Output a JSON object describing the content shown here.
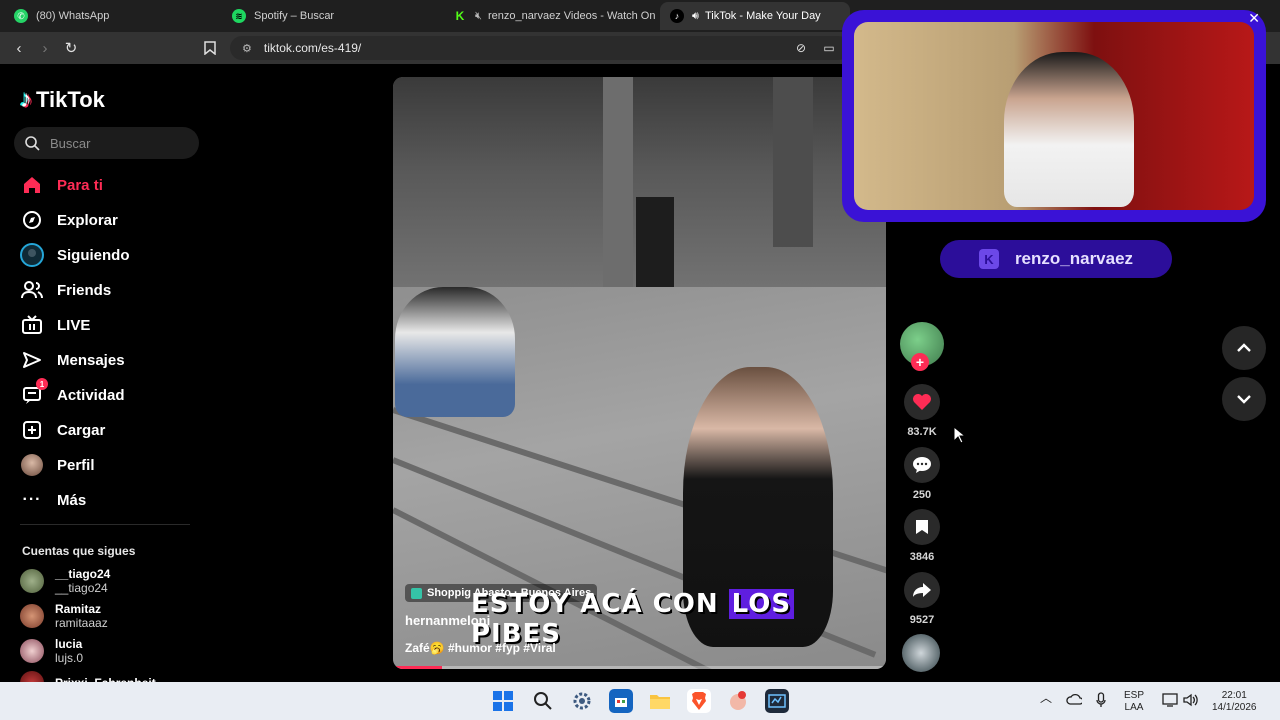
{
  "browser": {
    "tabs": [
      {
        "label": "(80) WhatsApp",
        "icon": "whatsapp-icon",
        "color": "#25d366"
      },
      {
        "label": "Spotify – Buscar",
        "icon": "spotify-icon",
        "color": "#1ed760"
      },
      {
        "label": "renzo_narvaez Videos - Watch On",
        "icon": "kick-icon",
        "color": "#53fc18"
      },
      {
        "label": "TikTok - Make Your Day",
        "icon": "tiktok-icon",
        "color": "#ffffff"
      }
    ],
    "url": "tiktok.com/es-419/"
  },
  "tiktok": {
    "logo": "TikTok",
    "search_placeholder": "Buscar",
    "nav": [
      {
        "label": "Para ti",
        "icon": "home-icon"
      },
      {
        "label": "Explorar",
        "icon": "compass-icon"
      },
      {
        "label": "Siguiendo",
        "icon": "following-icon"
      },
      {
        "label": "Friends",
        "icon": "friends-icon"
      },
      {
        "label": "LIVE",
        "icon": "live-icon"
      },
      {
        "label": "Mensajes",
        "icon": "send-icon"
      },
      {
        "label": "Actividad",
        "icon": "inbox-icon",
        "badge": "1"
      },
      {
        "label": "Cargar",
        "icon": "upload-icon"
      },
      {
        "label": "Perfil",
        "icon": "profile-avatar"
      },
      {
        "label": "Más",
        "icon": "more-icon"
      }
    ],
    "following_title": "Cuentas que sigues",
    "following": [
      {
        "name": "__tiago24",
        "user": "__tiago24"
      },
      {
        "name": "Ramitaz",
        "user": "ramitaaaz"
      },
      {
        "name": "lucia",
        "user": "lujs.0"
      },
      {
        "name": "Prixxi_Fahrenheit...",
        "user": ""
      }
    ]
  },
  "video": {
    "location": "Shoppig Abasto · Buenos Aires",
    "caption_pre": "ESTOY ACÁ CON ",
    "caption_hl": "LOS",
    "caption_post": " PIBES",
    "author": "hernanmeloni",
    "description": "Zafé🥱 #humor #fyp #Viral",
    "progress": 0.1,
    "likes": "83.7K",
    "comments": "250",
    "saves": "3846",
    "shares": "9527"
  },
  "stream": {
    "channel": "renzo_narvaez"
  },
  "taskbar": {
    "lang_top": "ESP",
    "lang_bottom": "LAA",
    "time": "22:01",
    "date": "14/1/2026"
  },
  "colors": {
    "accent": "#fe2c55",
    "kick_purple": "#3a12d6"
  }
}
